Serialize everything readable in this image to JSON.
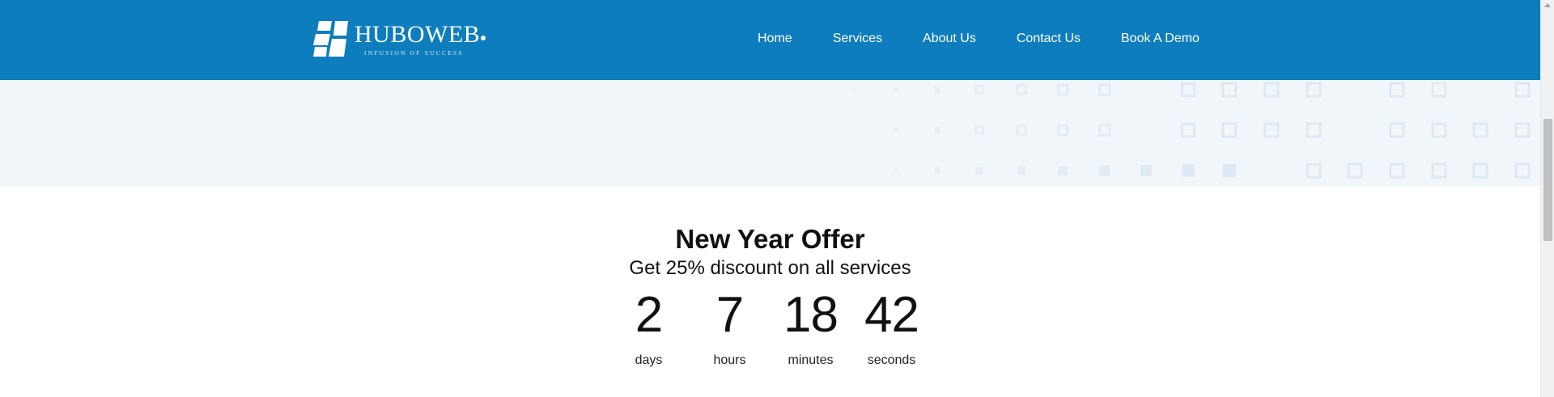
{
  "brand": {
    "name": "HUBOWEB",
    "tagline": "INFUSION OF SUCCESS",
    "color": "#0e7dbe"
  },
  "nav": {
    "items": [
      {
        "label": "Home"
      },
      {
        "label": "Services"
      },
      {
        "label": "About Us"
      },
      {
        "label": "Contact Us"
      },
      {
        "label": "Book A Demo"
      }
    ]
  },
  "offer": {
    "title": "New Year Offer",
    "subtitle": "Get 25% discount on all services",
    "countdown": [
      {
        "value": "2",
        "label": "days"
      },
      {
        "value": "7",
        "label": "hours"
      },
      {
        "value": "18",
        "label": "minutes"
      },
      {
        "value": "42",
        "label": "seconds"
      }
    ]
  },
  "colors": {
    "header_bg": "#0e7dbe",
    "band_bg": "#f1f6fb",
    "pattern": "#dde9f2"
  }
}
